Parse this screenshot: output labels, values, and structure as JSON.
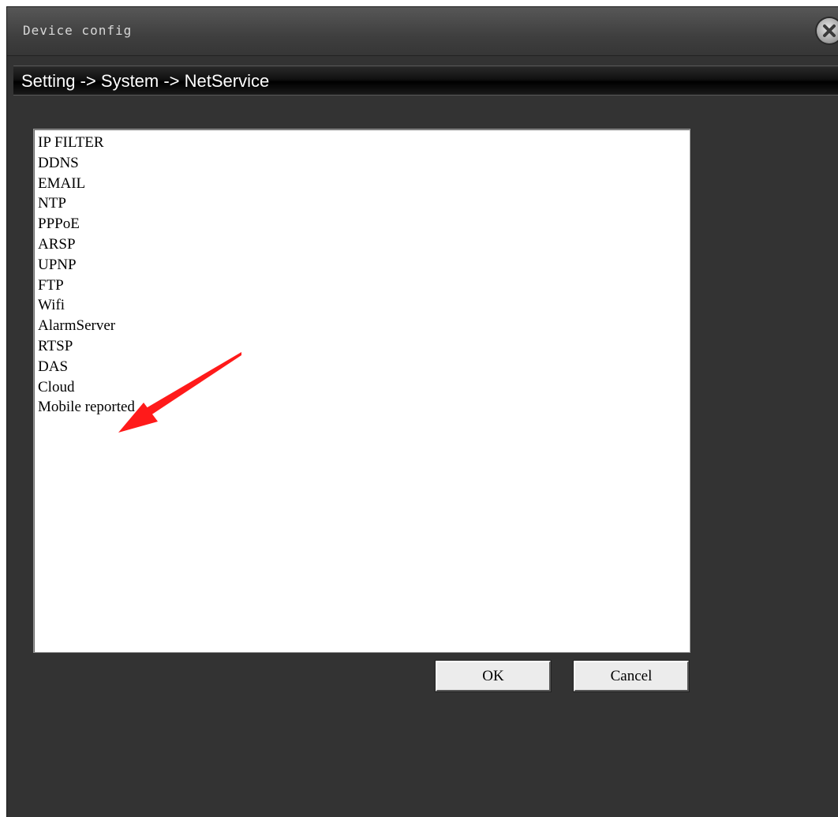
{
  "window": {
    "title": "Device config"
  },
  "breadcrumb": "Setting -> System -> NetService",
  "services": [
    "IP FILTER",
    "DDNS",
    "EMAIL",
    "NTP",
    "PPPoE",
    "ARSP",
    "UPNP",
    "FTP",
    "Wifi",
    "AlarmServer",
    "RTSP",
    "DAS",
    "Cloud",
    "Mobile reported"
  ],
  "buttons": {
    "ok": "OK",
    "cancel": "Cancel"
  },
  "annotation": {
    "color": "#ff1a1a",
    "points_to": "Wifi"
  },
  "icons": {
    "close": "close-icon"
  }
}
